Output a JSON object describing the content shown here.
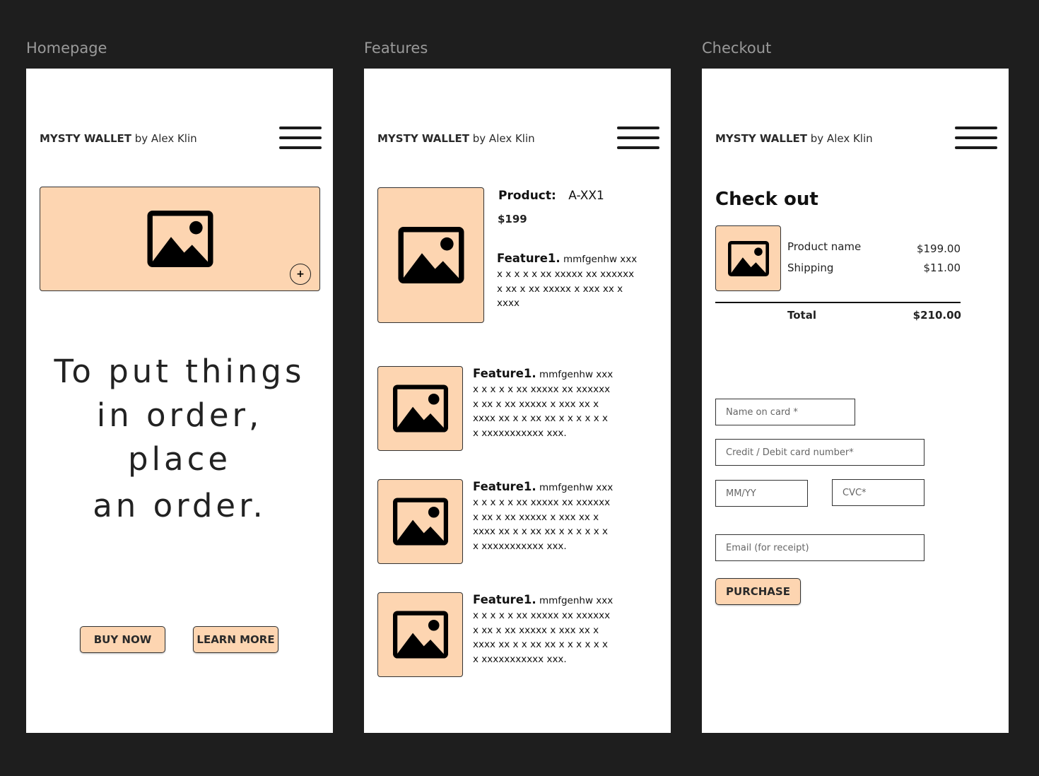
{
  "frames": {
    "homepage": {
      "label": "Homepage",
      "brand": {
        "name": "MYSTY WALLET",
        "by": "by Alex Klin"
      },
      "hero_lines": [
        "To put things",
        "in order,",
        "place",
        "an order."
      ],
      "plus_label": "+",
      "buttons": {
        "buy_now": "BUY NOW",
        "learn_more": "LEARN MORE"
      }
    },
    "features": {
      "label": "Features",
      "brand": {
        "name": "MYSTY WALLET",
        "by": "by Alex Klin"
      },
      "product": {
        "label": "Product:",
        "code": "A-XX1",
        "price": "$199"
      },
      "main_feature": {
        "title": "Feature1.",
        "lead": "mmfgenhw xxx",
        "body": "x x x x x xx xxxxx xx xxxxxx\nx xx x xx xxxxx x xxx xx x\nxxxx"
      },
      "items": [
        {
          "title": "Feature1.",
          "lead": "mmfgenhw xxx",
          "body": "x x x x x xx xxxxx xx xxxxxx\nx xx x xx xxxxx x xxx xx x\nxxxx xx x x xx xx x x x x x x\nx xxxxxxxxxxx  xxx."
        },
        {
          "title": "Feature1.",
          "lead": "mmfgenhw xxx",
          "body": "x x x x x xx xxxxx xx xxxxxx\nx xx x xx xxxxx x xxx xx x\nxxxx xx x x xx xx x x x x x x\nx xxxxxxxxxxx  xxx."
        },
        {
          "title": "Feature1.",
          "lead": "mmfgenhw xxx",
          "body": "x x x x x xx xxxxx xx xxxxxx\nx xx x xx xxxxx x xxx xx x\nxxxx xx x x xx xx x x x x x x\nx xxxxxxxxxxx  xxx."
        }
      ]
    },
    "checkout": {
      "label": "Checkout",
      "brand": {
        "name": "MYSTY WALLET",
        "by": "by Alex Klin"
      },
      "title": "Check out",
      "summary": {
        "product_name": "Product name",
        "product_price": "$199.00",
        "shipping_label": "Shipping",
        "shipping_price": "$11.00",
        "total_label": "Total",
        "total_price": "$210.00"
      },
      "fields": {
        "name_on_card": "Name on card *",
        "card_number": "Credit / Debit card number*",
        "expiry": "MM/YY",
        "cvc": "CVC*",
        "email": "Email (for receipt)"
      },
      "purchase_label": "PURCHASE"
    }
  },
  "colors": {
    "background": "#1e1e1e",
    "frame": "#ffffff",
    "accent_peach": "#fdd5b1",
    "label_gray": "#9a9a9a"
  },
  "icons": {
    "image_placeholder": "image-icon",
    "menu": "hamburger-menu-icon",
    "add": "plus-circle-icon"
  }
}
